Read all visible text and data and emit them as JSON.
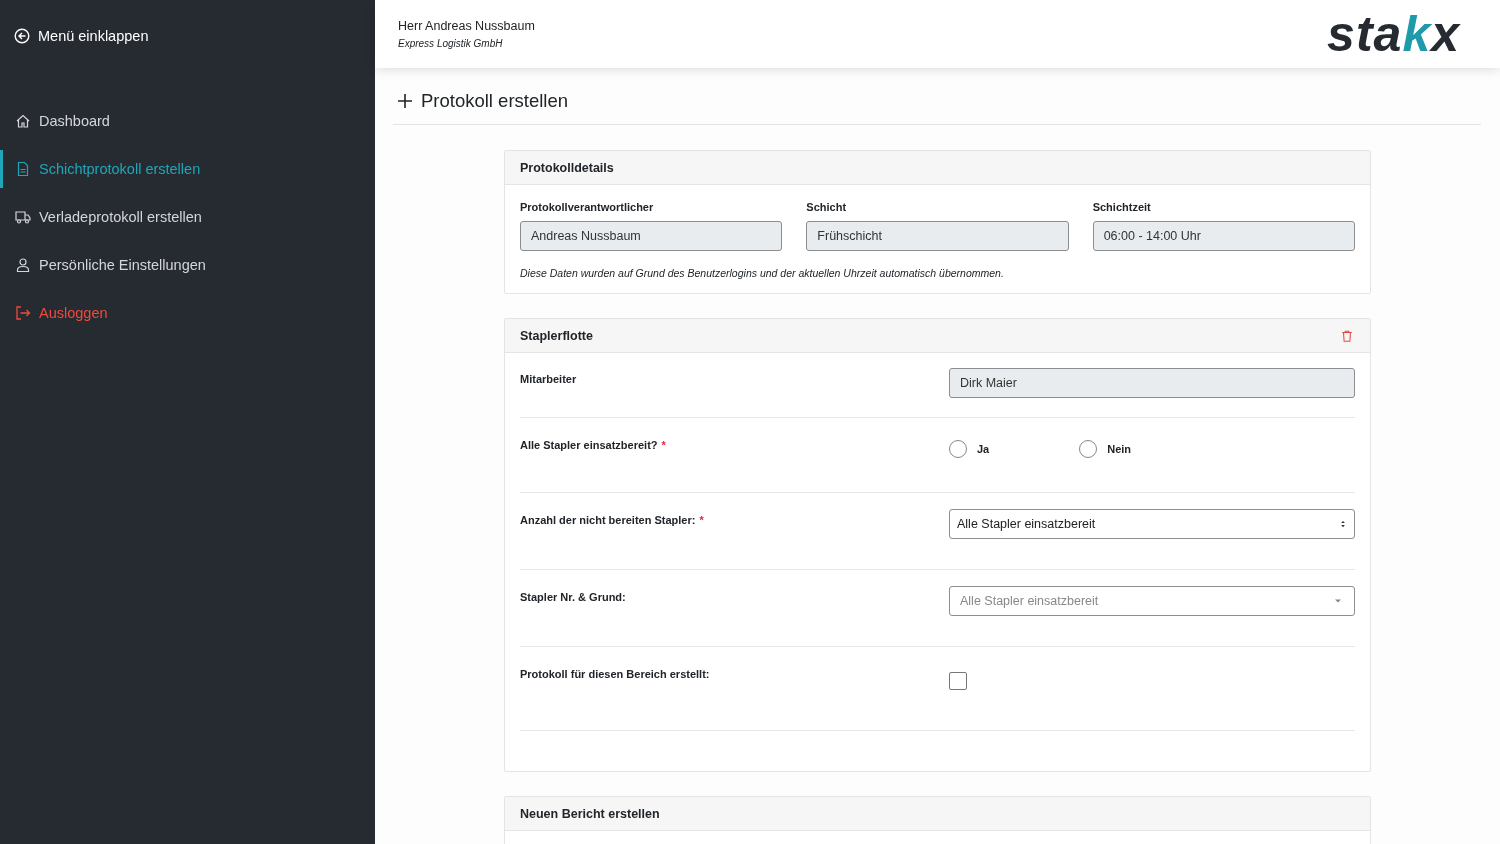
{
  "sidebar": {
    "collapse": {
      "label": "Menü einklappen"
    },
    "items": [
      {
        "kind": "home",
        "label": "Dashboard",
        "selected": false
      },
      {
        "kind": "file",
        "label": "Schichtprotokoll erstellen",
        "selected": true
      },
      {
        "kind": "truck",
        "label": "Verladeprotokoll erstellen",
        "selected": false
      },
      {
        "kind": "user",
        "label": "Persönliche Einstellungen",
        "selected": false
      },
      {
        "kind": "logout",
        "label": "Ausloggen",
        "selected": false
      }
    ]
  },
  "header": {
    "user_name": "Herr Andreas Nussbaum",
    "company": "Express Logistik GmbH",
    "logo": [
      {
        "text": "sta",
        "color": "#262a31"
      },
      {
        "text": "k",
        "color": "#1e9aaa"
      },
      {
        "text": "x",
        "color": "#262a31"
      }
    ]
  },
  "page_title": "Protokoll erstellen",
  "details_card": {
    "title": "Protokolldetails",
    "fields": [
      {
        "label": "Protokollverantwortlicher",
        "value": "Andreas Nussbaum"
      },
      {
        "label": "Schicht",
        "value": "Frühschicht"
      },
      {
        "label": "Schichtzeit",
        "value": "06:00 - 14:00 Uhr"
      }
    ],
    "note": "Diese Daten wurden auf Grund des Benutzerlogins und der aktuellen Uhrzeit automatisch übernommen."
  },
  "fleet_card": {
    "title": "Staplerflotte",
    "rows": [
      {
        "kind": "text",
        "label": "Mitarbeiter",
        "value": "Dirk Maier"
      },
      {
        "kind": "radio",
        "label": "Alle Stapler einsatzbereit?",
        "required_mark": "*",
        "options": [
          {
            "label": "Ja",
            "selected": false
          },
          {
            "label": "Nein",
            "selected": false
          }
        ]
      },
      {
        "kind": "select",
        "label": "Anzahl der nicht bereiten Stapler:",
        "required_mark": "*",
        "value": "Alle Stapler einsatzbereit"
      },
      {
        "kind": "dropdown",
        "label": "Stapler Nr. & Grund:",
        "placeholder": "Alle Stapler einsatzbereit"
      },
      {
        "kind": "checkbox",
        "label": "Protokoll für diesen Bereich erstellt:",
        "checked": false
      }
    ]
  },
  "next_card": {
    "title": "Neuen Bericht erstellen"
  }
}
